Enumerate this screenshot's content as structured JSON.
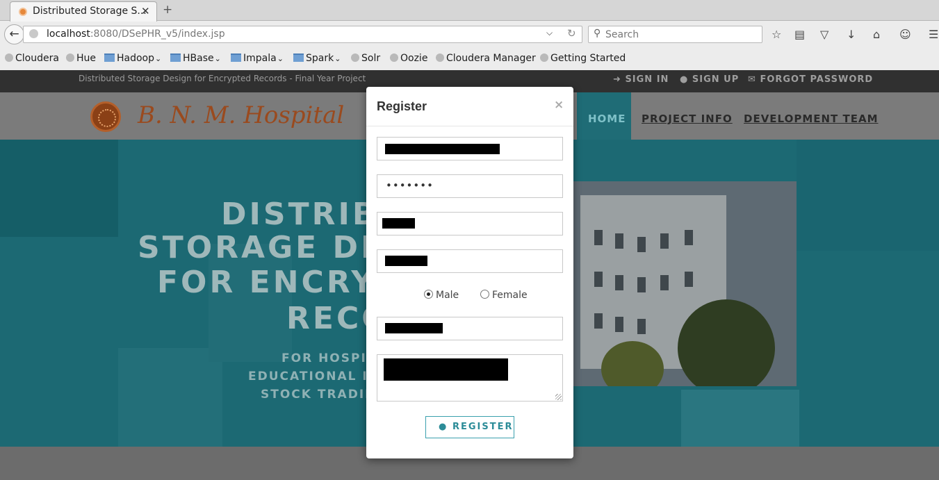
{
  "browser": {
    "tab_title": "Distributed Storage S...",
    "url_host": "localhost",
    "url_path": ":8080/DSePHR_v5/index.jsp",
    "search_placeholder": "Search",
    "bookmarks": [
      {
        "label": "Cloudera",
        "type": "site"
      },
      {
        "label": "Hue",
        "type": "site"
      },
      {
        "label": "Hadoop",
        "type": "folder"
      },
      {
        "label": "HBase",
        "type": "folder"
      },
      {
        "label": "Impala",
        "type": "folder"
      },
      {
        "label": "Spark",
        "type": "folder"
      },
      {
        "label": "Solr",
        "type": "site"
      },
      {
        "label": "Oozie",
        "type": "site"
      },
      {
        "label": "Cloudera Manager",
        "type": "site"
      },
      {
        "label": "Getting Started",
        "type": "site"
      }
    ]
  },
  "site": {
    "tagline": "Distributed Storage Design for Encrypted Records - Final Year Project",
    "top_links": {
      "sign_in": "SIGN IN",
      "sign_up": "SIGN UP",
      "forgot": "FORGOT PASSWORD"
    },
    "logo_text": "B. N. M. Hospital",
    "nav": {
      "home": "HOME",
      "project_info": "PROJECT INFO",
      "dev_team": "DEVELOPMENT TEAM"
    },
    "hero": {
      "title_lines": [
        "DISTRIB",
        "STORAGE DE",
        "FOR ENCRY",
        "RECO"
      ],
      "sub_lines": [
        "FOR HOSPIT",
        "EDUCATIONAL IN",
        "STOCK TRADIN"
      ]
    }
  },
  "modal": {
    "title": "Register",
    "close": "×",
    "password_value": "•••••••",
    "gender": {
      "male": "Male",
      "female": "Female",
      "selected": "male"
    },
    "register_label": "REGISTER"
  },
  "colors": {
    "accent": "#2c8c98",
    "hero_bg": "#1c6973",
    "brand": "#9a4a1e"
  }
}
